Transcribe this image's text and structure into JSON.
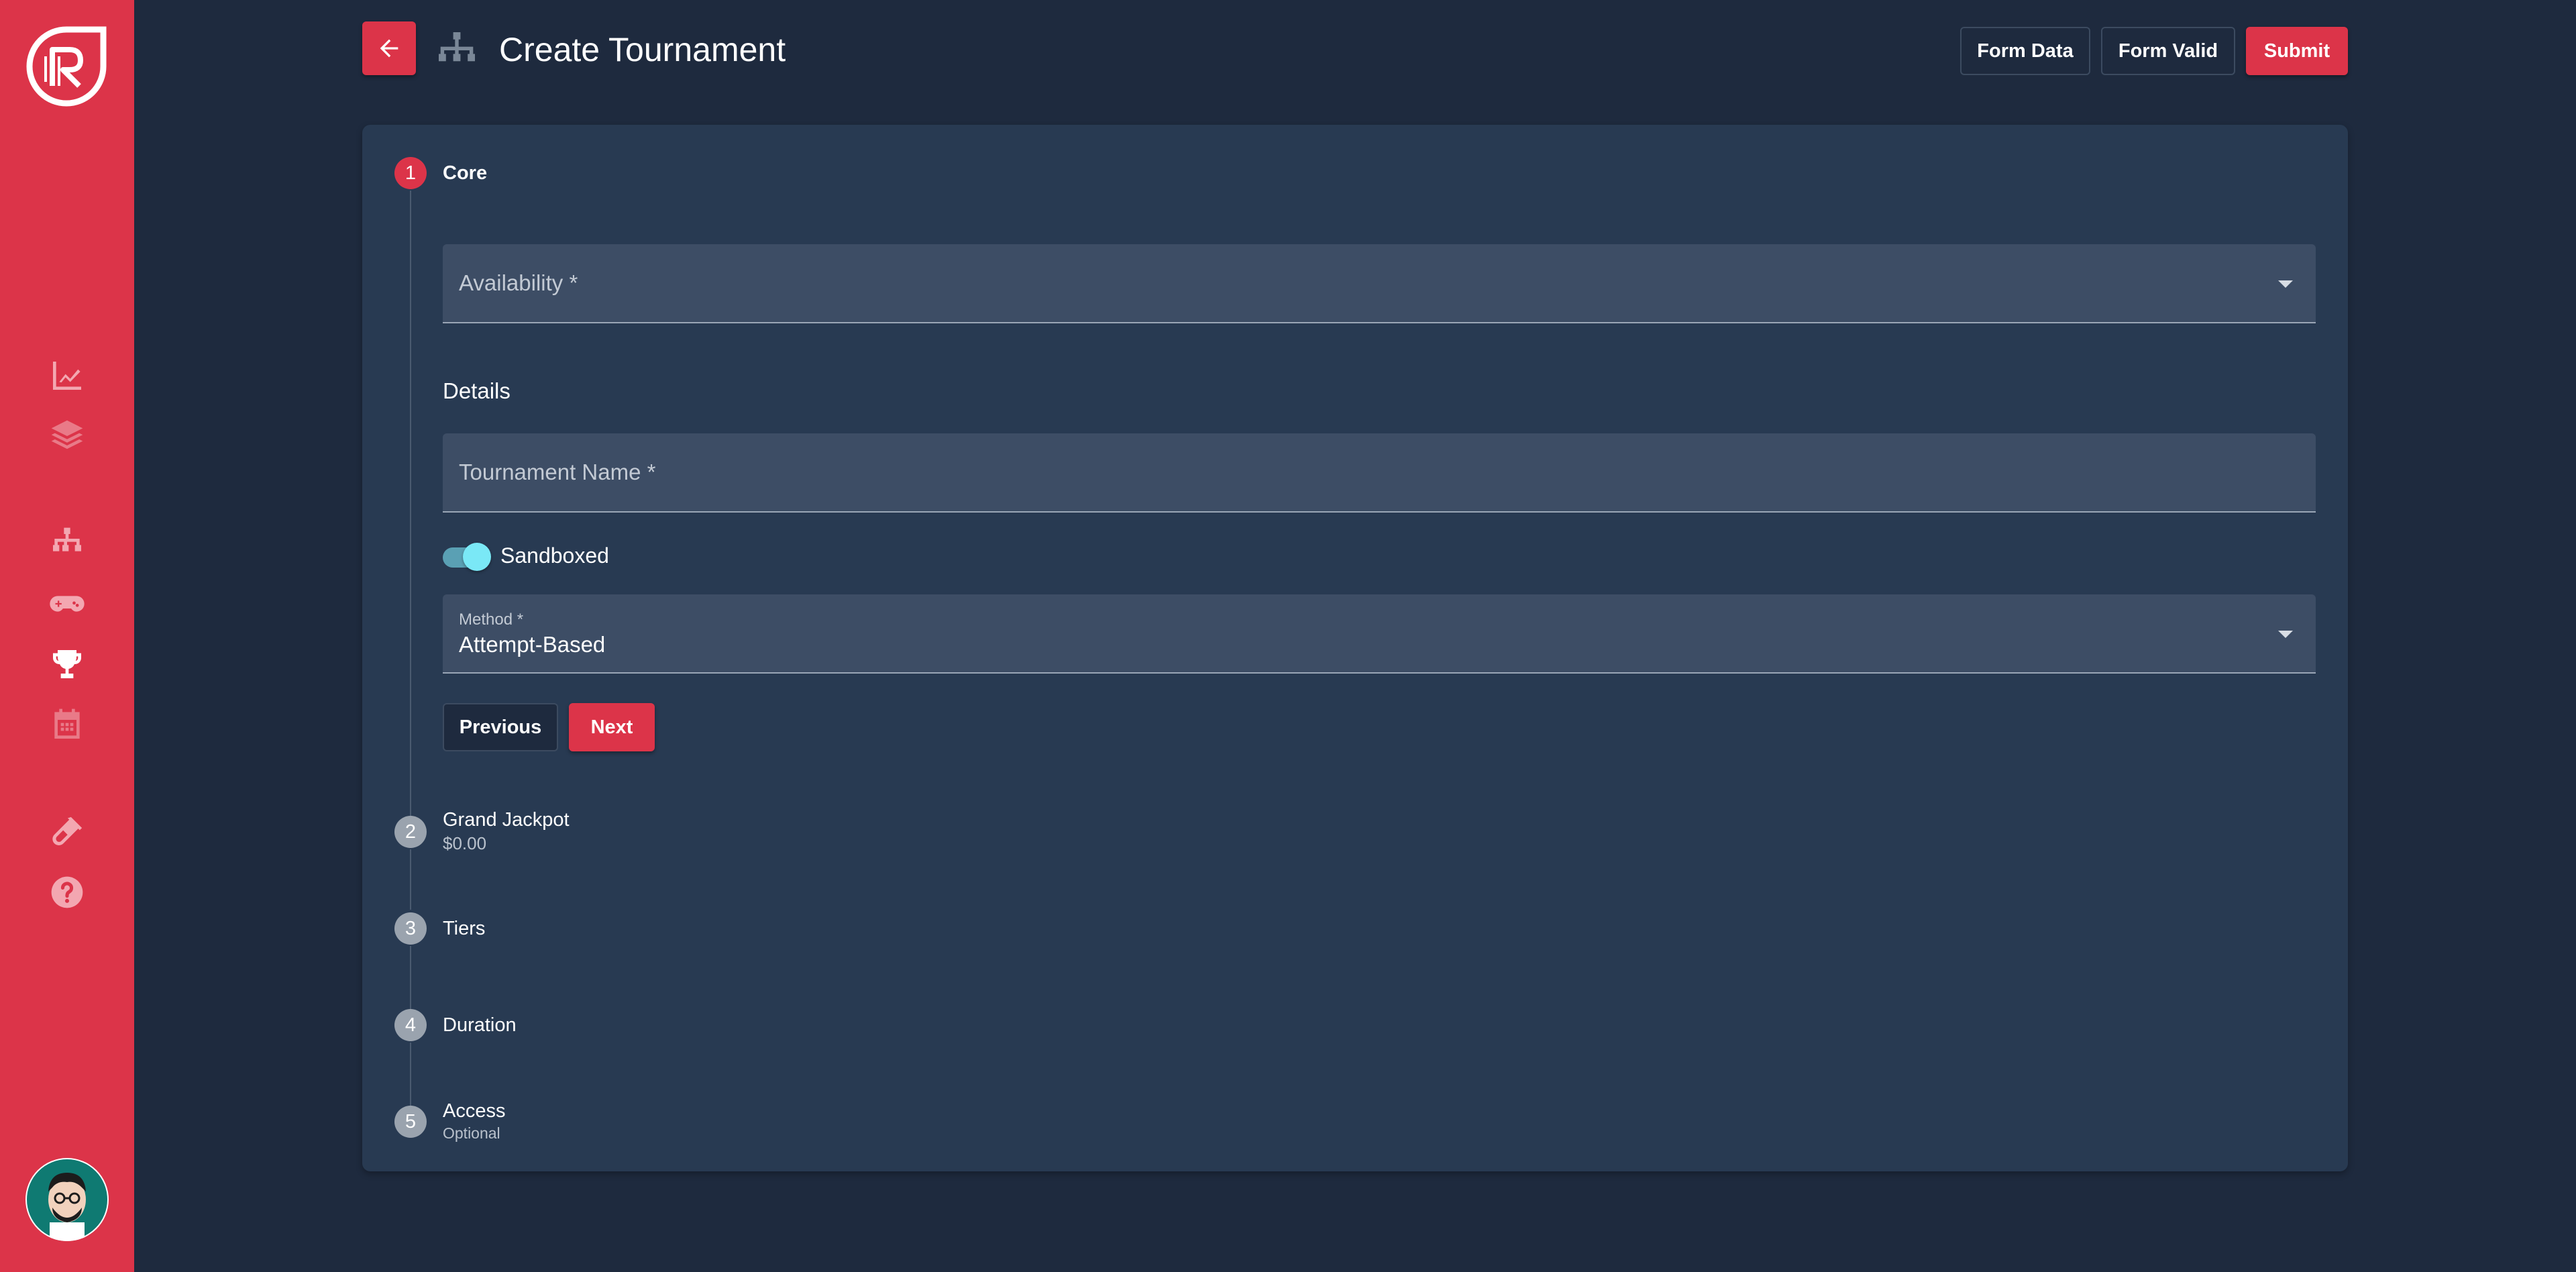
{
  "header": {
    "title": "Create Tournament",
    "buttons": {
      "form_data": "Form Data",
      "form_valid": "Form Valid",
      "submit": "Submit"
    }
  },
  "sidebar": {
    "items": [
      {
        "icon": "analytics-icon",
        "state": "active"
      },
      {
        "icon": "layers-icon",
        "state": "disabled"
      },
      {
        "icon": "sitemap-icon",
        "state": "active"
      },
      {
        "icon": "gamepad-icon",
        "state": "active"
      },
      {
        "icon": "trophy-icon",
        "state": "selected"
      },
      {
        "icon": "calendar-icon",
        "state": "disabled"
      },
      {
        "icon": "test-tube-icon",
        "state": "active"
      },
      {
        "icon": "help-icon",
        "state": "active"
      }
    ]
  },
  "stepper": {
    "steps": [
      {
        "number": "1",
        "label": "Core",
        "sub": "",
        "active": true
      },
      {
        "number": "2",
        "label": "Grand Jackpot",
        "sub": "$0.00",
        "active": false
      },
      {
        "number": "3",
        "label": "Tiers",
        "sub": "",
        "active": false
      },
      {
        "number": "4",
        "label": "Duration",
        "sub": "",
        "active": false
      },
      {
        "number": "5",
        "label": "Access",
        "sub": "Optional",
        "active": false
      }
    ]
  },
  "form": {
    "availability": {
      "label": "Availability *",
      "value": ""
    },
    "details_heading": "Details",
    "tournament_name": {
      "label": "Tournament Name *",
      "value": ""
    },
    "sandboxed": {
      "label": "Sandboxed",
      "checked": true
    },
    "method": {
      "label": "Method *",
      "value": "Attempt-Based"
    },
    "buttons": {
      "previous": "Previous",
      "next": "Next"
    }
  },
  "colors": {
    "accent": "#dc3449",
    "background": "#1e2a3e",
    "card": "#283a52",
    "field": "#3d4d65",
    "toggle": "#7ae8f6"
  }
}
